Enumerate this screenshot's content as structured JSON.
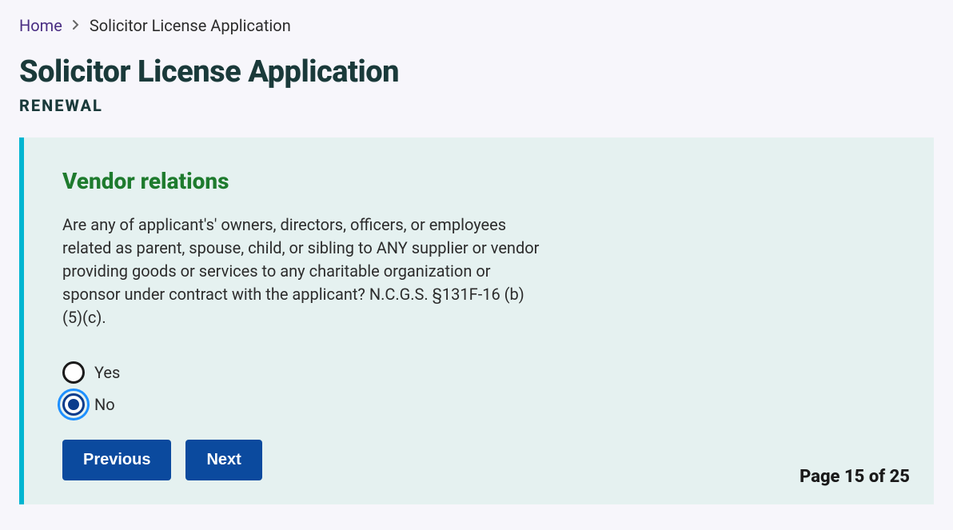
{
  "breadcrumb": {
    "home": "Home",
    "current": "Solicitor License Application"
  },
  "header": {
    "title": "Solicitor License Application",
    "subtitle": "RENEWAL"
  },
  "section": {
    "heading": "Vendor relations",
    "question": "Are any of applicant's' owners, directors, officers, or employees related as parent, spouse, child, or sibling to ANY supplier or vendor providing goods or services to any charitable organization or sponsor under contract with the applicant? N.C.G.S. §131F-16 (b)(5)(c)."
  },
  "radios": {
    "yes": "Yes",
    "no": "No",
    "selected": "no"
  },
  "buttons": {
    "previous": "Previous",
    "next": "Next"
  },
  "pagination": {
    "label": "Page 15 of 25"
  }
}
